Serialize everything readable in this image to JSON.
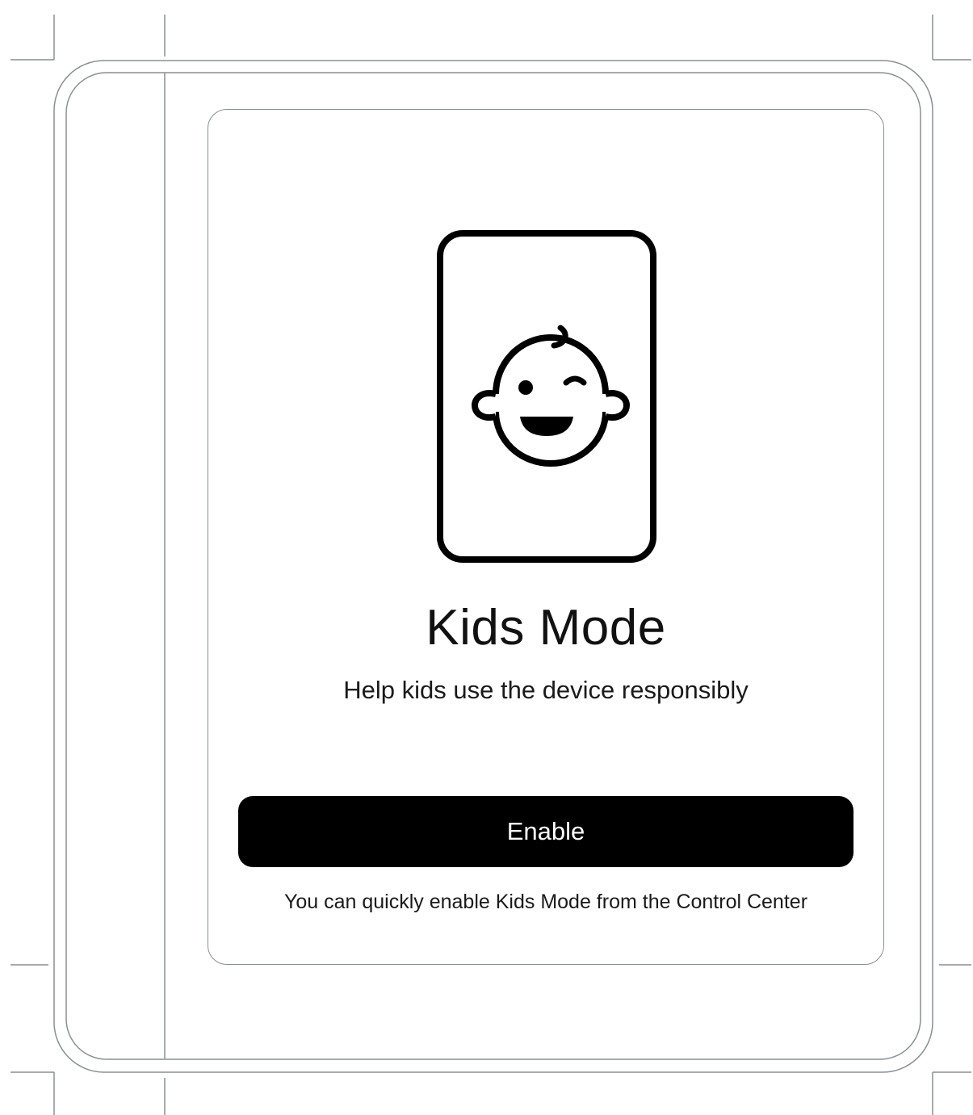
{
  "kids_mode": {
    "title": "Kids Mode",
    "subtitle": "Help kids use the device responsibly",
    "enable_label": "Enable",
    "hint": "You can quickly enable Kids Mode from the Control Center",
    "illustration_icon": "phone-baby-face-icon"
  },
  "colors": {
    "button_background": "#000000",
    "button_text": "#ffffff",
    "frame_lines": "#8a8f94"
  }
}
